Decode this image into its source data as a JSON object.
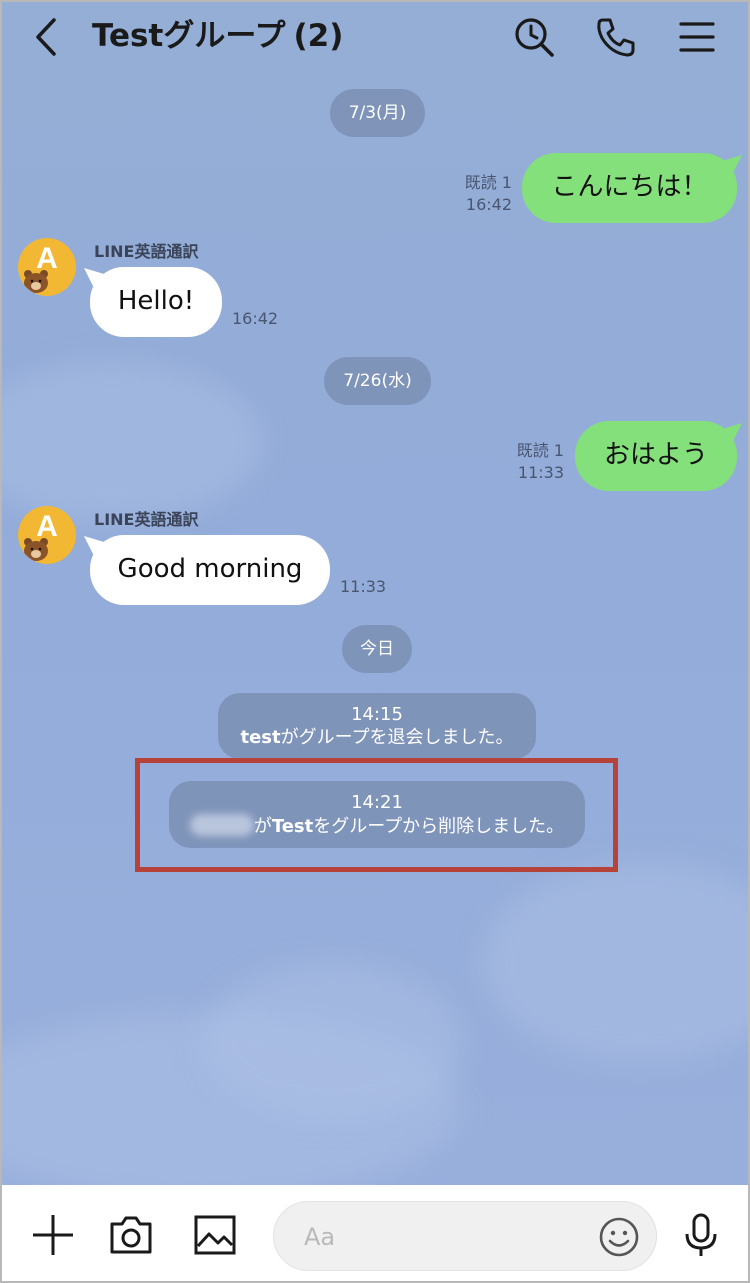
{
  "header": {
    "title": "Testグループ",
    "member_count": "(2)"
  },
  "dates": [
    "7/3(月)",
    "7/26(水)",
    "今日"
  ],
  "messages": [
    {
      "text": "こんにちは！",
      "read": "既読 1",
      "time": "16:42"
    },
    {
      "sender": "LINE英語通訳",
      "avatar_letter": "A",
      "text": "Hello!",
      "time": "16:42"
    },
    {
      "text": "おはよう",
      "read": "既読 1",
      "time": "11:33"
    },
    {
      "sender": "LINE英語通訳",
      "avatar_letter": "A",
      "text": "Good morning",
      "time": "11:33"
    }
  ],
  "system": [
    {
      "time": "14:15",
      "name": "test",
      "text": "がグループを退会しました。"
    },
    {
      "time": "14:21",
      "prefix": "が",
      "name": "Test",
      "text": "をグループから削除しました。"
    }
  ],
  "input": {
    "placeholder": "Aa"
  },
  "colors": {
    "accent_green": "#84e07a",
    "highlight_red": "#b6433a",
    "avatar_yellow": "#f2b833"
  },
  "icons": [
    "back-icon",
    "search-icon",
    "phone-icon",
    "menu-icon",
    "plus-icon",
    "camera-icon",
    "image-icon",
    "emoji-icon",
    "microphone-icon"
  ]
}
